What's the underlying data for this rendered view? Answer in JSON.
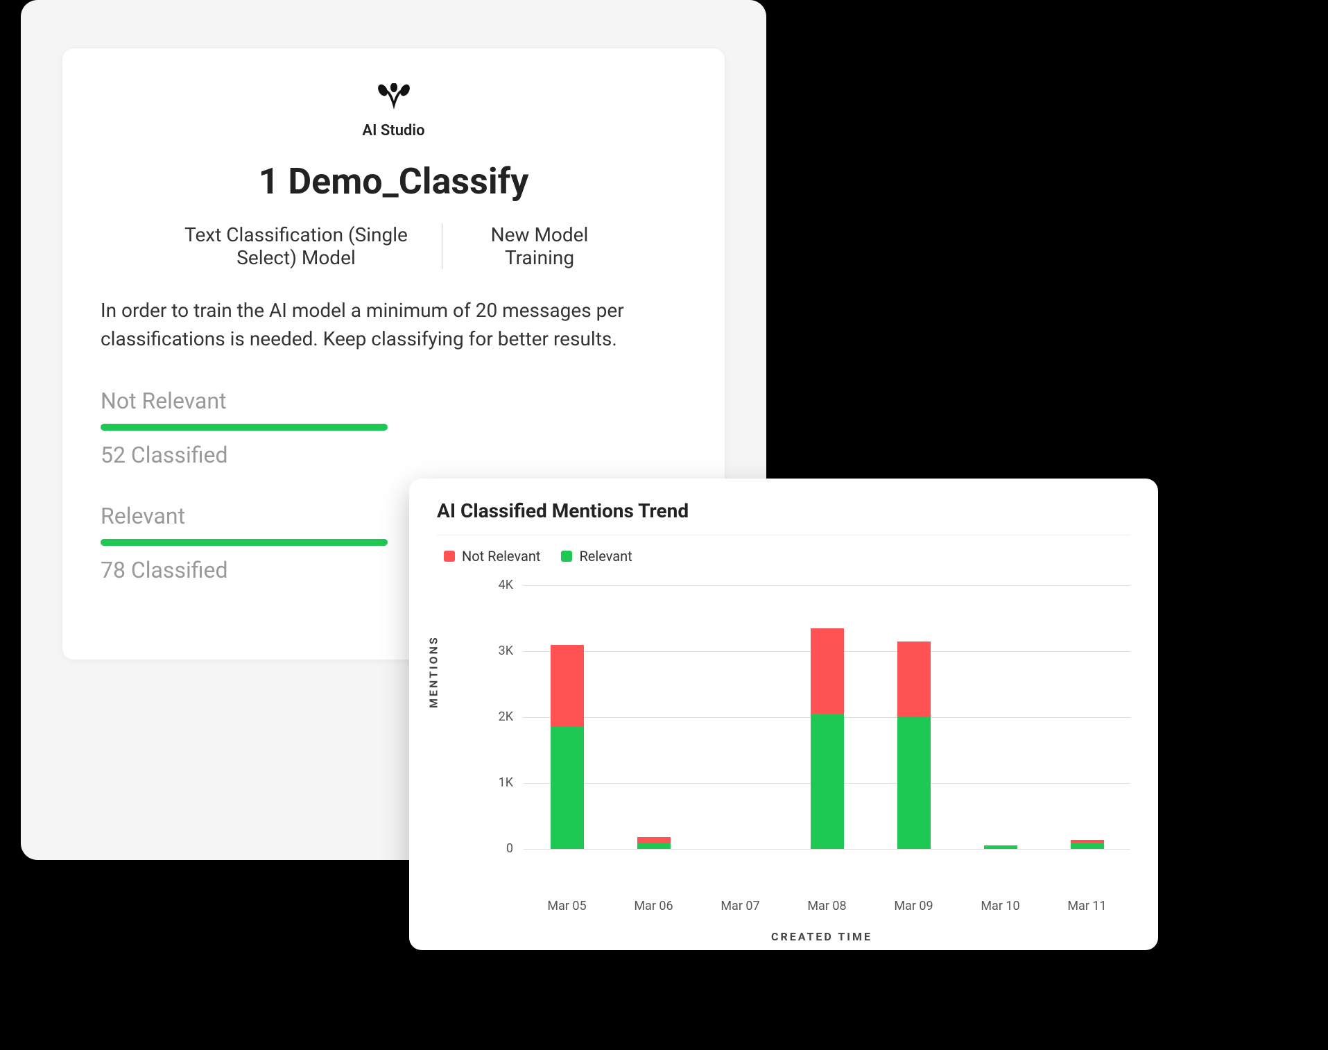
{
  "card": {
    "logo_label": "AI Studio",
    "title": "1 Demo_Classify",
    "subtitle_left": "Text Classification (Single Select) Model",
    "subtitle_right": "New Model Training",
    "description": "In order to train the AI model a minimum of 20 messages per classifications is needed. Keep classifying for better results.",
    "classes": [
      {
        "label": "Not Relevant",
        "count": "52 Classified"
      },
      {
        "label": "Relevant",
        "count": "78 Classified"
      }
    ]
  },
  "chart": {
    "title": "AI Classified Mentions Trend",
    "legend": [
      {
        "label": "Not Relevant",
        "color": "#ff5252"
      },
      {
        "label": "Relevant",
        "color": "#1fc853"
      }
    ],
    "ylabel": "MENTIONS",
    "xlabel": "CREATED TIME",
    "y_ticks": [
      "4K",
      "3K",
      "2K",
      "1K",
      "0"
    ],
    "x_ticks": [
      "Mar 05",
      "Mar 06",
      "Mar 07",
      "Mar 08",
      "Mar 09",
      "Mar 10",
      "Mar 11"
    ]
  },
  "chart_data": {
    "type": "bar",
    "title": "AI Classified Mentions Trend",
    "xlabel": "CREATED TIME",
    "ylabel": "MENTIONS",
    "ylim": [
      0,
      4000
    ],
    "categories": [
      "Mar 05",
      "Mar 06",
      "Mar 07",
      "Mar 08",
      "Mar 09",
      "Mar 10",
      "Mar 11"
    ],
    "series": [
      {
        "name": "Relevant",
        "color": "#1fc853",
        "values": [
          1850,
          100,
          0,
          2050,
          2000,
          50,
          80
        ]
      },
      {
        "name": "Not Relevant",
        "color": "#ff5252",
        "values": [
          1250,
          80,
          0,
          1300,
          1150,
          0,
          60
        ]
      }
    ]
  }
}
